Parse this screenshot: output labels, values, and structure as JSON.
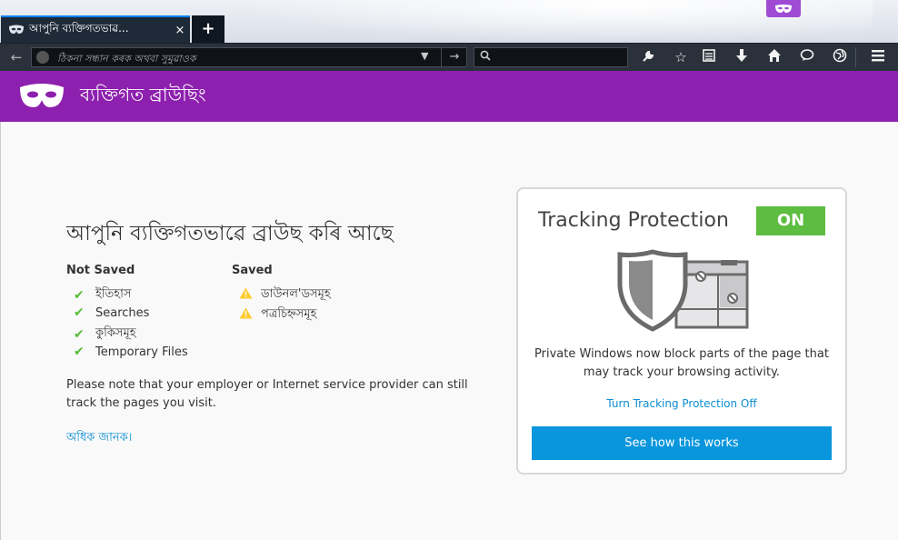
{
  "tab": {
    "title": "আপুনি ব্যক্তিগতভাৱ...",
    "close": "×",
    "new_tab": "+"
  },
  "urlbar": {
    "placeholder": "ঠিকনা সন্ধান কৰক অথবা সুমুৱাওক"
  },
  "toolbar": {
    "back": "←",
    "go": "→",
    "icons": [
      "back-icon",
      "search-icon",
      "wrench-icon",
      "star-icon",
      "reader-icon",
      "download-icon",
      "home-icon",
      "chat-icon",
      "globe-icon",
      "menu-icon"
    ]
  },
  "header": {
    "title": "ব্যক্তিগত ব্ৰাউছিং"
  },
  "main": {
    "title": "আপুনি ব্যক্তিগতভাৱে ব্ৰাউছ কৰি আছে",
    "not_saved_heading": "Not Saved",
    "not_saved_items": [
      "ইতিহাস",
      "Searches",
      "কুকিসমূহ",
      "Temporary Files"
    ],
    "saved_heading": "Saved",
    "saved_items": [
      "ডাউনল'ডসমূহ",
      "পত্ৰচিহ্নসমূহ"
    ],
    "note": "Please note that your employer or Internet service provider can still track the pages you visit.",
    "learn_more": "অধিক জানক।"
  },
  "tracking": {
    "title": "Tracking Protection",
    "status": "ON",
    "description": "Private Windows now block parts of the page that may track your browsing activity.",
    "turn_off_link": "Turn Tracking Protection Off",
    "how_button": "See how this works"
  },
  "colors": {
    "header_purple": "#8d20ae",
    "toggle_green": "#5cbd40",
    "button_blue": "#0996dc",
    "link_blue": "#0a8dd1"
  }
}
